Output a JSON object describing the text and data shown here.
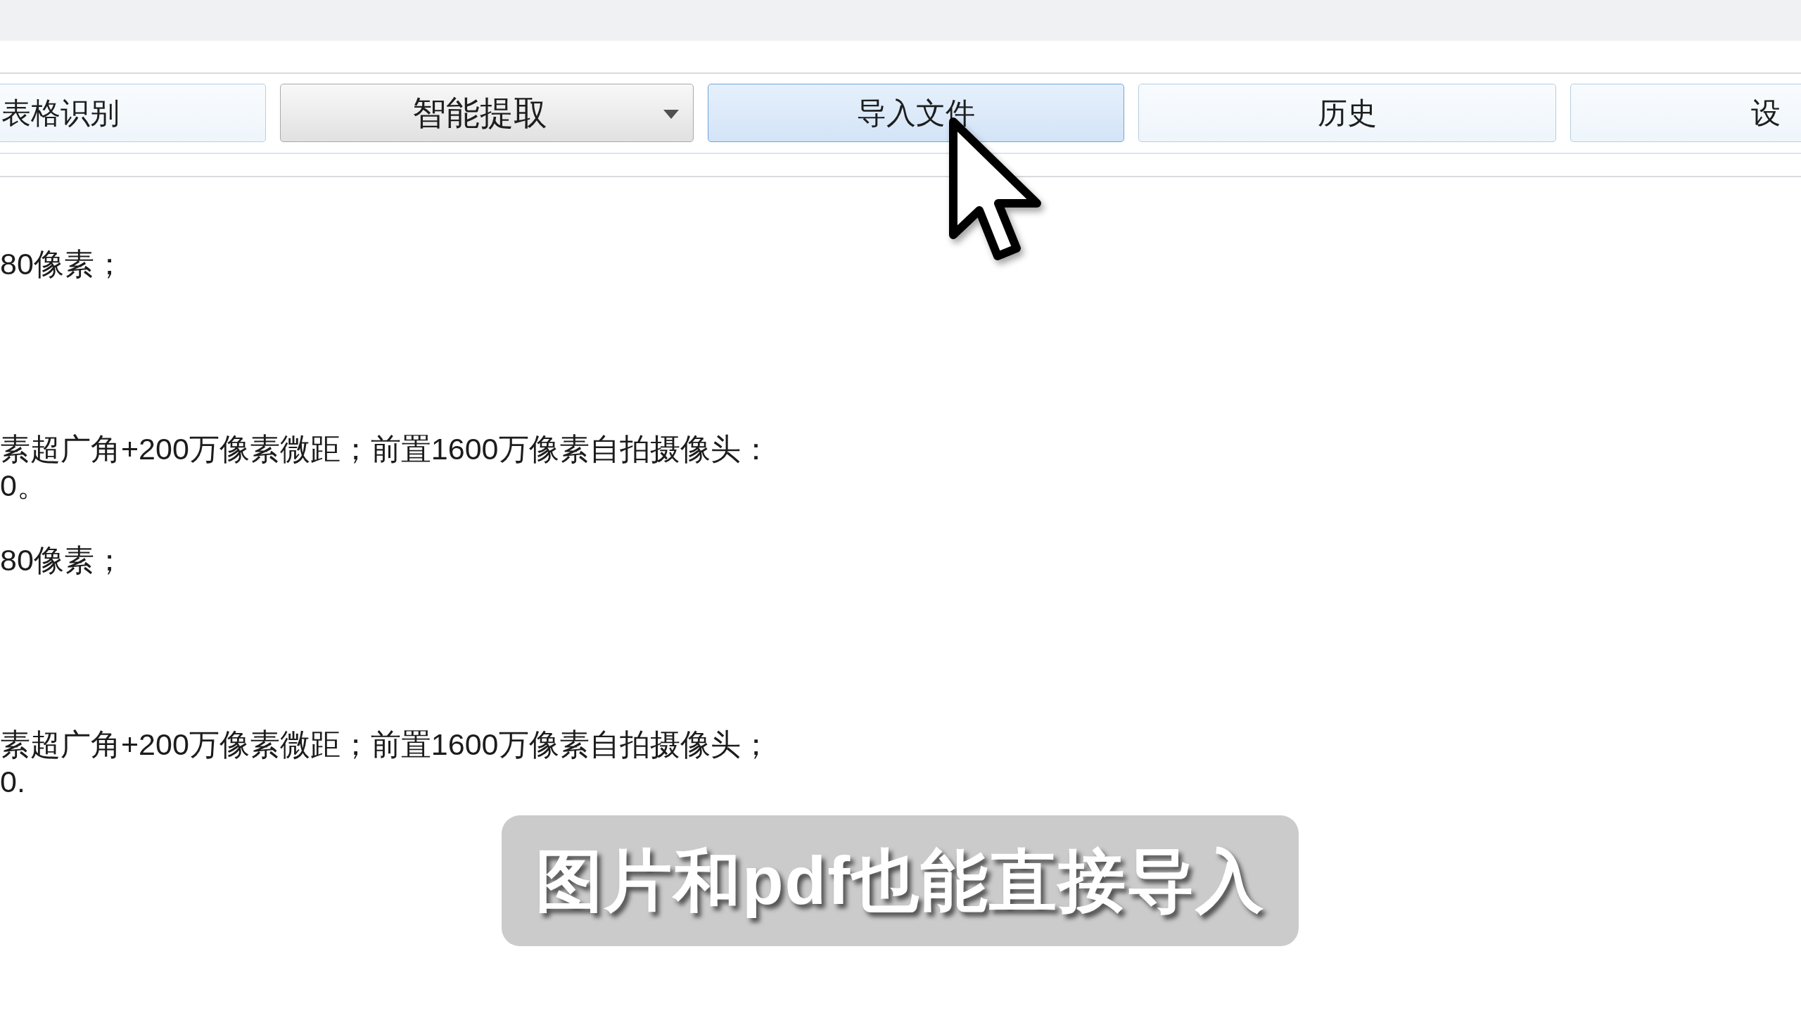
{
  "toolbar": {
    "buttons": [
      {
        "kind": "button",
        "label": "表格识别",
        "highlighted": false
      },
      {
        "kind": "dropdown",
        "label": "智能提取",
        "highlighted": false
      },
      {
        "kind": "button",
        "label": "导入文件",
        "highlighted": true
      },
      {
        "kind": "button",
        "label": "历史",
        "highlighted": false
      },
      {
        "kind": "button",
        "label": "设",
        "highlighted": false
      }
    ]
  },
  "document": {
    "lines": [
      "80像素；",
      "素超广角+200万像素微距；前置1600万像素自拍摄像头：",
      "0。",
      "80像素；",
      "素超广角+200万像素微距；前置1600万像素自拍摄像头；",
      "0."
    ]
  },
  "subtitle": "图片和pdf也能直接导入"
}
